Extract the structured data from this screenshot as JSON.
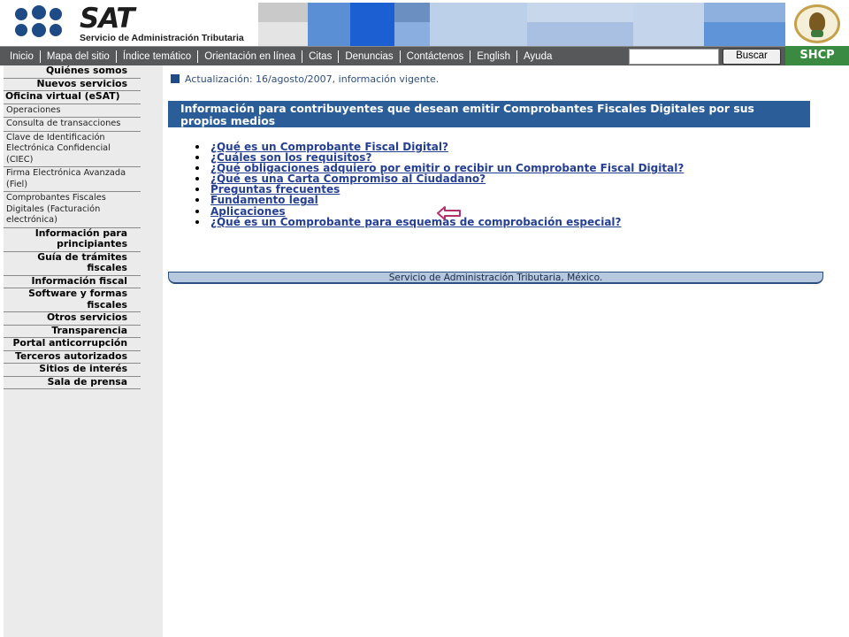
{
  "header": {
    "logo_title": "SAT",
    "logo_subtitle": "Servicio de Administración Tributaria"
  },
  "nav": {
    "items": [
      "Inicio",
      "Mapa del sitio",
      "Índice temático",
      "Orientación en línea",
      "Citas",
      "Denuncias",
      "Contáctenos",
      "English",
      "Ayuda"
    ],
    "search_value": "",
    "search_button": "Buscar",
    "shcp_label": "SHCP"
  },
  "sidebar": {
    "items": [
      {
        "label": "Quiénes somos",
        "style": "main"
      },
      {
        "label": "Nuevos servicios",
        "style": "main"
      },
      {
        "label": "Oficina virtual (eSAT)",
        "style": "main-left"
      },
      {
        "label": "Operaciones",
        "style": "sub"
      },
      {
        "label": "Consulta de transacciones",
        "style": "sub"
      },
      {
        "label": "Clave de Identificación Electrónica Confidencial (CIEC)",
        "style": "sub"
      },
      {
        "label": "Firma Electrónica Avanzada (Fiel)",
        "style": "sub"
      },
      {
        "label": "Comprobantes Fiscales Digitales (Facturación electrónica)",
        "style": "sub"
      },
      {
        "label": "Información para principiantes",
        "style": "main"
      },
      {
        "label": "Guía de trámites fiscales",
        "style": "main"
      },
      {
        "label": "Información fiscal",
        "style": "main"
      },
      {
        "label": "Software y formas fiscales",
        "style": "main"
      },
      {
        "label": "Otros servicios",
        "style": "main"
      },
      {
        "label": "Transparencia",
        "style": "main"
      },
      {
        "label": "Portal anticorrupción",
        "style": "main"
      },
      {
        "label": "Terceros autorizados",
        "style": "main"
      },
      {
        "label": "Sitios de interés",
        "style": "main"
      },
      {
        "label": "Sala de prensa",
        "style": "main"
      }
    ]
  },
  "main": {
    "update_text": "Actualización: 16/agosto/2007, información vigente.",
    "title": "Información para contribuyentes que desean emitir Comprobantes Fiscales Digitales por sus propios medios",
    "links": [
      "¿Qué es un Comprobante Fiscal Digital?",
      "¿Cuáles son los requisitos?",
      "¿Qué obligaciones adquiero por emitir o recibir un Comprobante Fiscal Digital?",
      "¿Qué es una Carta Compromiso al Ciudadano?",
      "Preguntas frecuentes",
      "Fundamento legal",
      "Aplicaciones",
      "¿Qué es un Comprobante para esquemas de comprobación especial?"
    ],
    "footer": "Servicio de Administración Tributaria, México."
  },
  "colors": {
    "nav_bg": "#57585a",
    "shcp_green": "#3b8a41",
    "title_blue": "#2b5d98",
    "link_blue": "#253f93",
    "arrow_magenta": "#b0336f",
    "sidebar_bg": "#ebebeb"
  },
  "icons": [
    "sat-logo-dots",
    "mexico-seal-icon",
    "arrow-left-icon",
    "update-square-icon",
    "bullet-icon"
  ]
}
